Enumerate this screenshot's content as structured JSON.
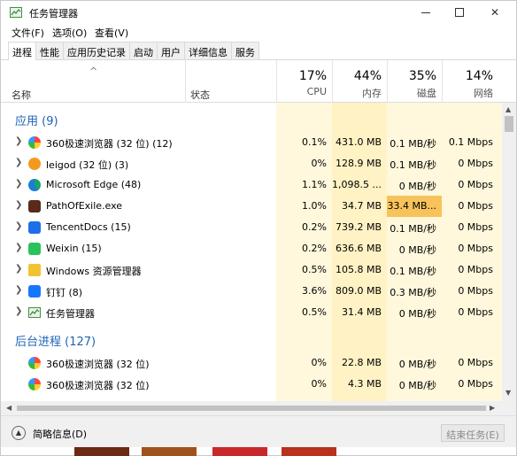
{
  "window": {
    "title": "任务管理器"
  },
  "menu": [
    "文件(F)",
    "选项(O)",
    "查看(V)"
  ],
  "tabs": [
    "进程",
    "性能",
    "应用历史记录",
    "启动",
    "用户",
    "详细信息",
    "服务"
  ],
  "active_tab": "进程",
  "header": {
    "name": "名称",
    "status": "状态",
    "cpu": {
      "pct": "17%",
      "label": "CPU"
    },
    "mem": {
      "pct": "44%",
      "label": "内存"
    },
    "disk": {
      "pct": "35%",
      "label": "磁盘"
    },
    "net": {
      "pct": "14%",
      "label": "网络"
    }
  },
  "groups": {
    "apps": "应用 (9)",
    "background": "后台进程 (127)"
  },
  "apps": [
    {
      "name": "360极速浏览器 (32 位) (12)",
      "cpu": "0.1%",
      "mem": "431.0 MB",
      "disk": "0.1 MB/秒",
      "net": "0.1 Mbps"
    },
    {
      "name": "leigod (32 位) (3)",
      "cpu": "0%",
      "mem": "128.9 MB",
      "disk": "0.1 MB/秒",
      "net": "0 Mbps"
    },
    {
      "name": "Microsoft Edge (48)",
      "cpu": "1.1%",
      "mem": "1,098.5 ...",
      "disk": "0 MB/秒",
      "net": "0 Mbps"
    },
    {
      "name": "PathOfExile.exe",
      "cpu": "1.0%",
      "mem": "34.7 MB",
      "disk": "33.4 MB...",
      "net": "0 Mbps"
    },
    {
      "name": "TencentDocs (15)",
      "cpu": "0.2%",
      "mem": "739.2 MB",
      "disk": "0.1 MB/秒",
      "net": "0 Mbps"
    },
    {
      "name": "Weixin (15)",
      "cpu": "0.2%",
      "mem": "636.6 MB",
      "disk": "0 MB/秒",
      "net": "0 Mbps"
    },
    {
      "name": "Windows 资源管理器",
      "cpu": "0.5%",
      "mem": "105.8 MB",
      "disk": "0.1 MB/秒",
      "net": "0 Mbps"
    },
    {
      "name": "钉钉 (8)",
      "cpu": "3.6%",
      "mem": "809.0 MB",
      "disk": "0.3 MB/秒",
      "net": "0 Mbps"
    },
    {
      "name": "任务管理器",
      "cpu": "0.5%",
      "mem": "31.4 MB",
      "disk": "0 MB/秒",
      "net": "0 Mbps"
    }
  ],
  "background": [
    {
      "name": "360极速浏览器 (32 位)",
      "cpu": "0%",
      "mem": "22.8 MB",
      "disk": "0 MB/秒",
      "net": "0 Mbps"
    },
    {
      "name": "360极速浏览器 (32 位)",
      "cpu": "0%",
      "mem": "4.3 MB",
      "disk": "0 MB/秒",
      "net": "0 Mbps"
    }
  ],
  "footer": {
    "fewer_details": "简略信息(D)",
    "end_task": "结束任务(E)"
  },
  "colors": {
    "group": "#1e64b4",
    "col_light": "#fff8dc",
    "col_mid": "#fff2c4",
    "hot": "#f8c35a"
  }
}
